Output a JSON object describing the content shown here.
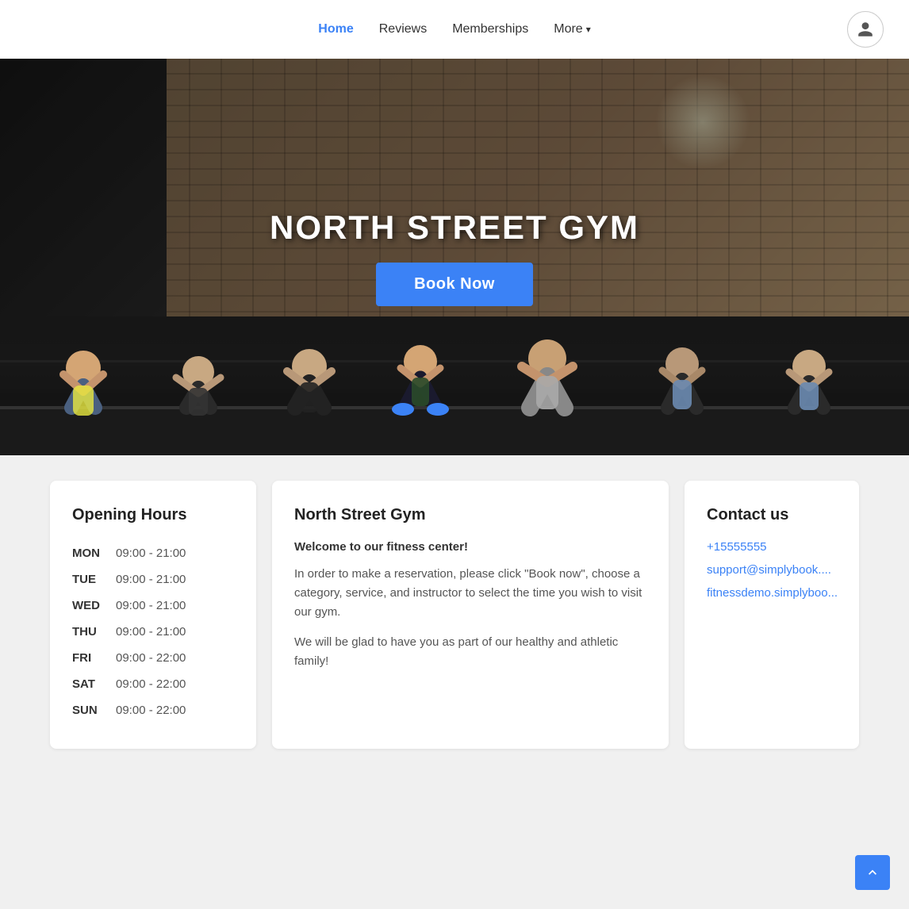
{
  "navbar": {
    "links": [
      {
        "label": "Home",
        "active": true
      },
      {
        "label": "Reviews",
        "active": false
      },
      {
        "label": "Memberships",
        "active": false
      },
      {
        "label": "More",
        "active": false,
        "has_dropdown": true
      }
    ],
    "avatar_label": "User profile"
  },
  "hero": {
    "title": "NORTH STREET GYM",
    "book_button": "Book Now"
  },
  "opening_hours": {
    "title": "Opening Hours",
    "days": [
      {
        "day": "MON",
        "hours": "09:00 - 21:00"
      },
      {
        "day": "TUE",
        "hours": "09:00 - 21:00"
      },
      {
        "day": "WED",
        "hours": "09:00 - 21:00"
      },
      {
        "day": "THU",
        "hours": "09:00 - 21:00"
      },
      {
        "day": "FRI",
        "hours": "09:00 - 22:00"
      },
      {
        "day": "SAT",
        "hours": "09:00 - 22:00"
      },
      {
        "day": "SUN",
        "hours": "09:00 - 22:00"
      }
    ]
  },
  "about": {
    "title": "North Street Gym",
    "welcome": "Welcome to our fitness center!",
    "description1": "In order to make a reservation, please click \"Book now\", choose a category, service, and instructor to select the time you wish to visit our gym.",
    "description2": "We will be glad to have you as part of our healthy and athletic family!"
  },
  "contact": {
    "title": "Contact us",
    "phone": "+15555555",
    "email": "support@simplybook....",
    "website": "fitnessdemo.simplyboo..."
  },
  "scroll_top_label": "Scroll to top",
  "colors": {
    "accent": "#3b82f6",
    "text_primary": "#222",
    "text_secondary": "#555",
    "border": "#e0e0e0"
  }
}
